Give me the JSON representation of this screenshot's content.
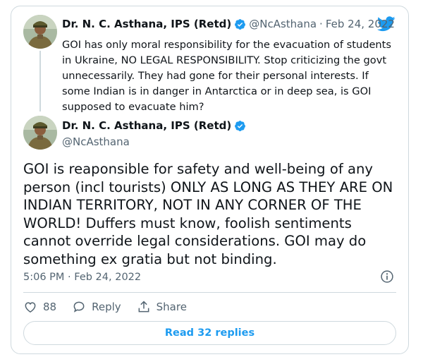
{
  "quoted_tweet": {
    "name": "Dr. N. C. Asthana, IPS (Retd)",
    "handle": "@NcAsthana",
    "separator": "·",
    "date": "Feb 24, 2022",
    "text": "GOI  has only moral responsibility for the evacuation of students in Ukraine, NO LEGAL RESPONSIBILITY. Stop criticizing the govt unnecessarily. They had gone for their personal interests. If some Indian is in danger in Antarctica or in deep sea, is GOI supposed to evacuate him?"
  },
  "main_tweet": {
    "name": "Dr. N. C. Asthana, IPS (Retd)",
    "handle": "@NcAsthana",
    "text": "GOI is reaponsible for safety and well-being of any person (incl tourists) ONLY AS LONG AS THEY ARE ON INDIAN TERRITORY, NOT IN ANY CORNER OF THE WORLD! Duffers must know, foolish sentiments cannot override legal considerations. GOI may do something ex gratia but not binding.",
    "time": "5:06 PM",
    "separator": " · ",
    "date": "Feb 24, 2022"
  },
  "actions": {
    "like_count": "88",
    "reply_label": "Reply",
    "share_label": "Share"
  },
  "read_replies_label": "Read 32 replies",
  "colors": {
    "accent": "#1d9bf0",
    "muted": "#536471",
    "border": "#cfd9de",
    "text": "#0f1419"
  },
  "icons": [
    "twitter-bird-icon",
    "verified-badge-icon",
    "info-icon",
    "heart-icon",
    "reply-bubble-icon",
    "share-icon"
  ]
}
